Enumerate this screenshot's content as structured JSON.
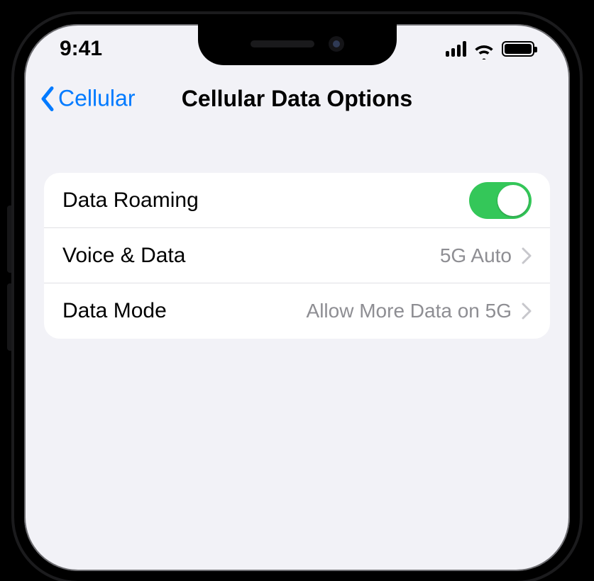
{
  "status": {
    "time": "9:41"
  },
  "nav": {
    "back_label": "Cellular",
    "title": "Cellular Data Options"
  },
  "rows": {
    "data_roaming": {
      "label": "Data Roaming",
      "on": true
    },
    "voice_data": {
      "label": "Voice & Data",
      "value": "5G Auto"
    },
    "data_mode": {
      "label": "Data Mode",
      "value": "Allow More Data on 5G"
    }
  }
}
